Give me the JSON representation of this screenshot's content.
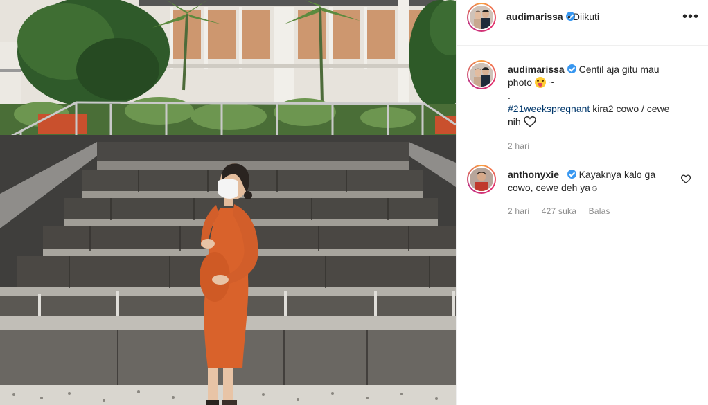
{
  "post": {
    "author": "audimarissa",
    "follow_state": "Diikuti",
    "follow_dot": "•",
    "more_glyph": "•••"
  },
  "caption": {
    "username": "audimarissa",
    "line1": "Centil aja gitu mau",
    "line2_text": "photo",
    "line2_after": "~",
    "line3": ".",
    "hashtag": "#21weekspregnant",
    "line4_rest": "kira2 cowo / cewe",
    "line5": "nih",
    "time": "2 hari"
  },
  "comment": {
    "username": "anthonyxie_",
    "line1": "Kayaknya kalo ga",
    "line2": "cowo, cewe deh ya",
    "emoji": "☺",
    "time": "2 hari",
    "likes": "427 suka",
    "reply": "Balas"
  },
  "colors": {
    "verified": "#3897f0",
    "hashtag": "#00376b",
    "meta": "#8e8e8e",
    "dress": "#d9622b"
  }
}
